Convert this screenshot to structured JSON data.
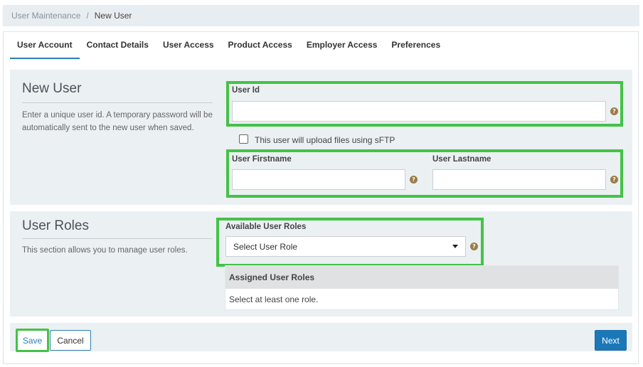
{
  "breadcrumb": {
    "parent": "User Maintenance",
    "separator": "/",
    "current": "New User"
  },
  "tabs": [
    {
      "label": "User Account",
      "active": true
    },
    {
      "label": "Contact Details",
      "active": false
    },
    {
      "label": "User Access",
      "active": false
    },
    {
      "label": "Product Access",
      "active": false
    },
    {
      "label": "Employer Access",
      "active": false
    },
    {
      "label": "Preferences",
      "active": false
    }
  ],
  "new_user": {
    "title": "New User",
    "description": "Enter a unique user id. A temporary password will be automatically sent to the new user when saved.",
    "user_id": {
      "label": "User Id",
      "value": "",
      "placeholder": ""
    },
    "sftp_checkbox": {
      "label": "This user will upload files using sFTP",
      "checked": false
    },
    "firstname": {
      "label": "User Firstname",
      "value": "",
      "placeholder": ""
    },
    "lastname": {
      "label": "User Lastname",
      "value": "",
      "placeholder": ""
    }
  },
  "user_roles": {
    "title": "User Roles",
    "description": "This section allows you to manage user roles.",
    "available_label": "Available User Roles",
    "select_value": "Select User Role",
    "assigned_header": "Assigned User Roles",
    "assigned_empty": "Select at least one role."
  },
  "icons": {
    "help_glyph": "?"
  },
  "buttons": {
    "save": "Save",
    "cancel": "Cancel",
    "next": "Next"
  },
  "colors": {
    "accent": "#1b78b8",
    "highlight": "#44c246",
    "help_icon": "#9a7d46",
    "section_bg": "#ebf0f3"
  }
}
